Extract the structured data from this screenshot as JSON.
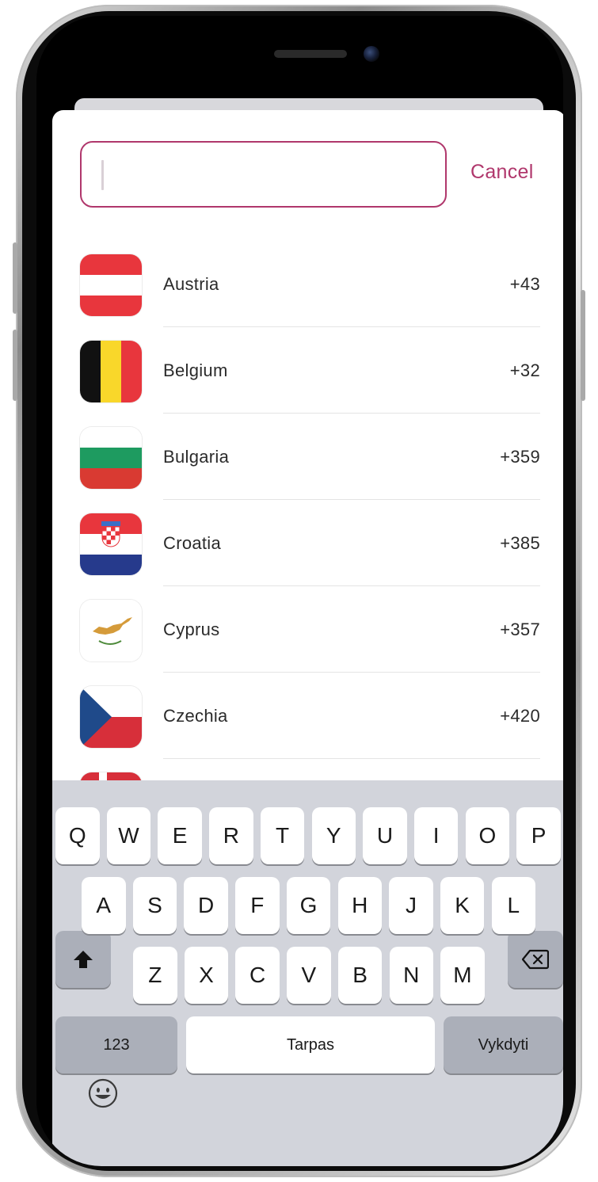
{
  "search": {
    "value": "",
    "cancel_label": "Cancel",
    "accent_color": "#b0376c"
  },
  "countries": [
    {
      "name": "Austria",
      "code": "+43",
      "flag_icon": "austria-flag-icon"
    },
    {
      "name": "Belgium",
      "code": "+32",
      "flag_icon": "belgium-flag-icon"
    },
    {
      "name": "Bulgaria",
      "code": "+359",
      "flag_icon": "bulgaria-flag-icon"
    },
    {
      "name": "Croatia",
      "code": "+385",
      "flag_icon": "croatia-flag-icon"
    },
    {
      "name": "Cyprus",
      "code": "+357",
      "flag_icon": "cyprus-flag-icon"
    },
    {
      "name": "Czechia",
      "code": "+420",
      "flag_icon": "czechia-flag-icon"
    }
  ],
  "keyboard": {
    "row1": [
      "Q",
      "W",
      "E",
      "R",
      "T",
      "Y",
      "U",
      "I",
      "O",
      "P"
    ],
    "row2": [
      "A",
      "S",
      "D",
      "F",
      "G",
      "H",
      "J",
      "K",
      "L"
    ],
    "row3": [
      "Z",
      "X",
      "C",
      "V",
      "B",
      "N",
      "M"
    ],
    "numbers_label": "123",
    "space_label": "Tarpas",
    "return_label": "Vykdyti",
    "shift_icon": "shift-icon",
    "backspace_icon": "backspace-icon",
    "emoji_icon": "emoji-icon"
  }
}
